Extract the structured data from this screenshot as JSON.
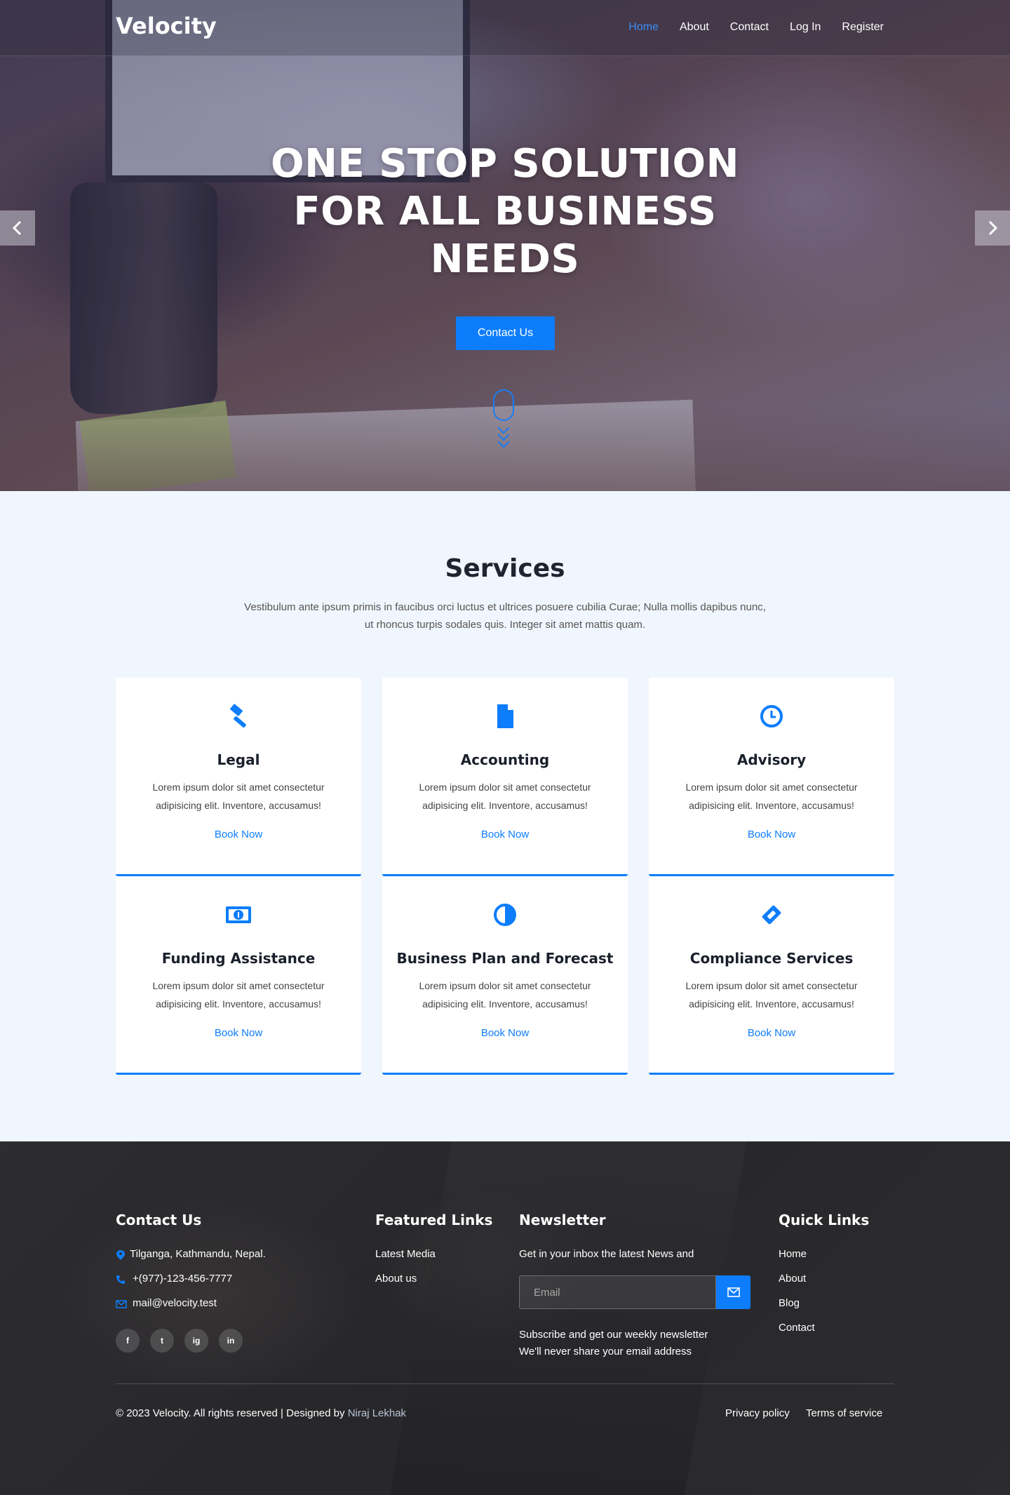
{
  "header": {
    "brand": "Velocity",
    "nav": [
      "Home",
      "About",
      "Contact",
      "Log In",
      "Register"
    ]
  },
  "hero": {
    "title": "ONE STOP SOLUTION FOR ALL BUSINESS NEEDS",
    "cta_label": "Contact Us"
  },
  "services": {
    "title": "Services",
    "description": "Vestibulum ante ipsum primis in faucibus orci luctus et ultrices posuere cubilia Curae; Nulla mollis dapibus nunc, ut rhoncus turpis sodales quis. Integer sit amet mattis quam.",
    "cards": [
      {
        "title": "Legal",
        "icon": "gavel-icon",
        "text": "Lorem ipsum dolor sit amet consectetur adipisicing elit. Inventore, accusamus!",
        "link": "Book Now"
      },
      {
        "title": "Accounting",
        "icon": "document-icon",
        "text": "Lorem ipsum dolor sit amet consectetur adipisicing elit. Inventore, accusamus!",
        "link": "Book Now"
      },
      {
        "title": "Advisory",
        "icon": "clock-icon",
        "text": "Lorem ipsum dolor sit amet consectetur adipisicing elit. Inventore, accusamus!",
        "link": "Book Now"
      },
      {
        "title": "Funding Assistance",
        "icon": "money-bill-icon",
        "text": "Lorem ipsum dolor sit amet consectetur adipisicing elit. Inventore, accusamus!",
        "link": "Book Now"
      },
      {
        "title": "Business Plan and Forecast",
        "icon": "half-circle-icon",
        "text": "Lorem ipsum dolor sit amet consectetur adipisicing elit. Inventore, accusamus!",
        "link": "Book Now"
      },
      {
        "title": "Compliance Services",
        "icon": "ticket-icon",
        "text": "Lorem ipsum dolor sit amet consectetur adipisicing elit. Inventore, accusamus!",
        "link": "Book Now"
      }
    ]
  },
  "footer": {
    "contact": {
      "heading": "Contact Us",
      "address": "Tilganga, Kathmandu, Nepal.",
      "phone": "+(977)-123-456-7777",
      "email": "mail@velocity.test",
      "social": [
        "f",
        "t",
        "ig",
        "in"
      ]
    },
    "featured": {
      "heading": "Featured Links",
      "links": [
        "Latest Media",
        "About us"
      ]
    },
    "newsletter": {
      "heading": "Newsletter",
      "intro": "Get in your inbox the latest News and",
      "placeholder": "Email",
      "note1": "Subscribe and get our weekly newsletter",
      "note2": "We'll never share your email address"
    },
    "quick": {
      "heading": "Quick Links",
      "links": [
        "Home",
        "About",
        "Blog",
        "Contact"
      ]
    },
    "copyright": "© 2023 Velocity. All rights reserved | Designed by",
    "designer": "Niraj Lekhak",
    "legal": [
      "Privacy policy",
      "Terms of service"
    ]
  },
  "colors": {
    "accent": "#0d7dfb",
    "page_bg": "#f0f6fd",
    "heading": "#1f2430"
  }
}
